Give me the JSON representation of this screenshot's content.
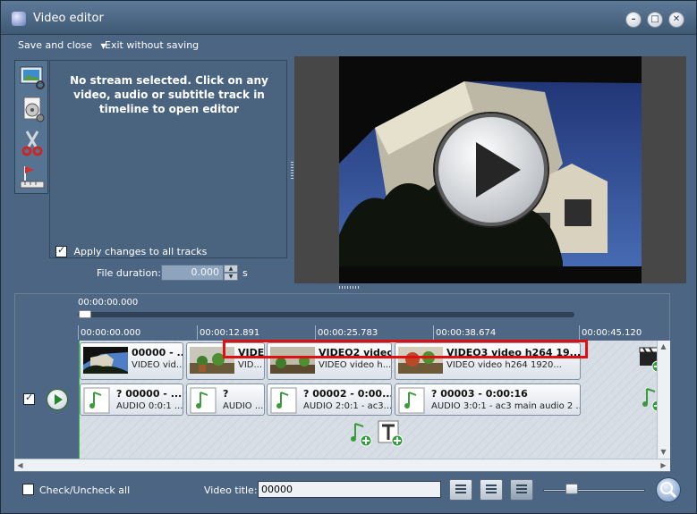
{
  "window": {
    "title": "Video editor",
    "minimize": "–",
    "maximize": "□",
    "close": "✕"
  },
  "menu": {
    "save_close": "Save and close",
    "save_close_arrow": "▼",
    "exit": "Exit without saving"
  },
  "tools": [
    "video-preview-icon",
    "disc-settings-icon",
    "scissors-icon",
    "chapter-marker-icon"
  ],
  "editor": {
    "message": "No stream selected. Click on any video, audio or subtitle track in timeline to open editor",
    "apply_all_label": "Apply changes to all tracks",
    "apply_all_checked": true,
    "duration_label": "File duration:",
    "duration_value": "0.000",
    "duration_unit": "s"
  },
  "timeline": {
    "current_time": "00:00:00.000",
    "ruler": [
      "00:00:00.000",
      "00:00:12.891",
      "00:00:25.783",
      "00:00:38.674",
      "00:00:45.120"
    ],
    "video_clips": [
      {
        "title": "00000 - ...",
        "info": "VIDEO vid..."
      },
      {
        "title": "VIDE0 video...",
        "info": "VID..."
      },
      {
        "title": "VIDEO2 video...",
        "info": "VIDEO video h..."
      },
      {
        "title": "VIDEO3 video h264 19...",
        "info": "VIDEO video h264 1920..."
      }
    ],
    "audio_clips": [
      {
        "title": "? 00000 - ...",
        "info": "AUDIO 0:0:1 ..."
      },
      {
        "title": "?",
        "info": "AUDIO ..."
      },
      {
        "title": "? 00002 - 0:00...",
        "info": "AUDIO 2:0:1 - ac3..."
      },
      {
        "title": "? 00003 - 0:00:16",
        "info": "AUDIO 3:0:1 - ac3 main audio 2 ..."
      }
    ],
    "track_checked": true
  },
  "bottom": {
    "check_all_label": "Check/Uncheck all",
    "video_title_label": "Video title:",
    "video_title_value": "00000"
  },
  "colors": {
    "accent": "#e01010",
    "panel": "#4b6582"
  }
}
